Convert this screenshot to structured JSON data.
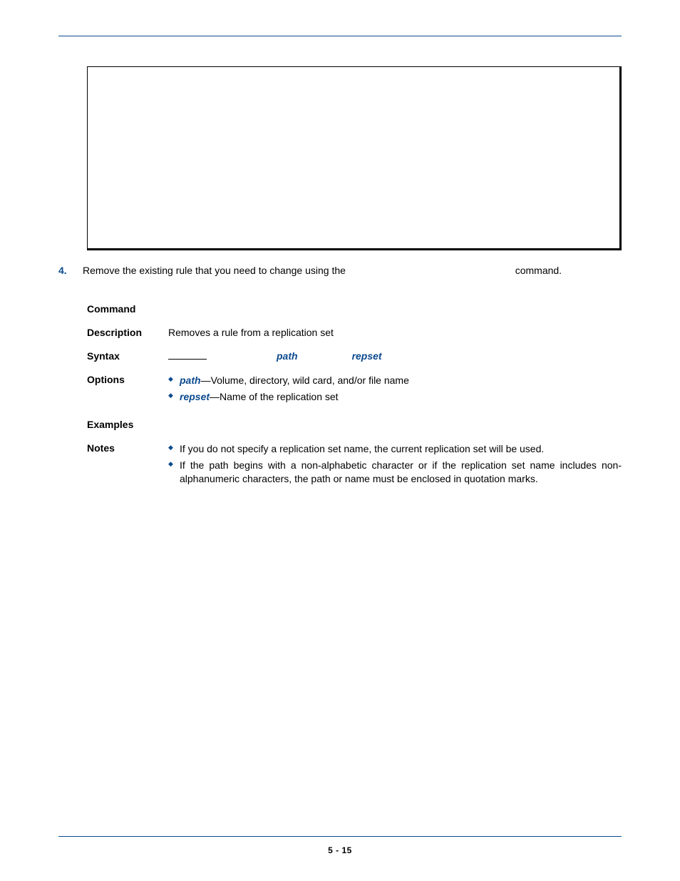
{
  "step": {
    "number": "4.",
    "text_before": "Remove the existing rule that you need to change using the ",
    "code_inline": "",
    "text_after": " command."
  },
  "command": {
    "labels": {
      "command": "Command",
      "description": "Description",
      "syntax": "Syntax",
      "options": "Options",
      "examples": "Examples",
      "notes": "Notes"
    },
    "command_name": "",
    "description": "Removes a rule from a replication set",
    "syntax": {
      "prefix": "",
      "arg1": "path",
      "mid": "",
      "arg2": "repset",
      "suffix": ""
    },
    "options": [
      {
        "arg": "path",
        "desc": "—Volume, directory, wild card, and/or file name"
      },
      {
        "arg": "repset",
        "desc": "—Name of the replication set"
      }
    ],
    "examples": "",
    "notes": [
      "If you do not specify a replication set name, the current replication set will be used.",
      "If the path begins with a non-alphabetic character or if the replication set name includes non-alphanumeric characters, the path or name must be enclosed in quotation marks."
    ]
  },
  "page_number": "5 - 15"
}
